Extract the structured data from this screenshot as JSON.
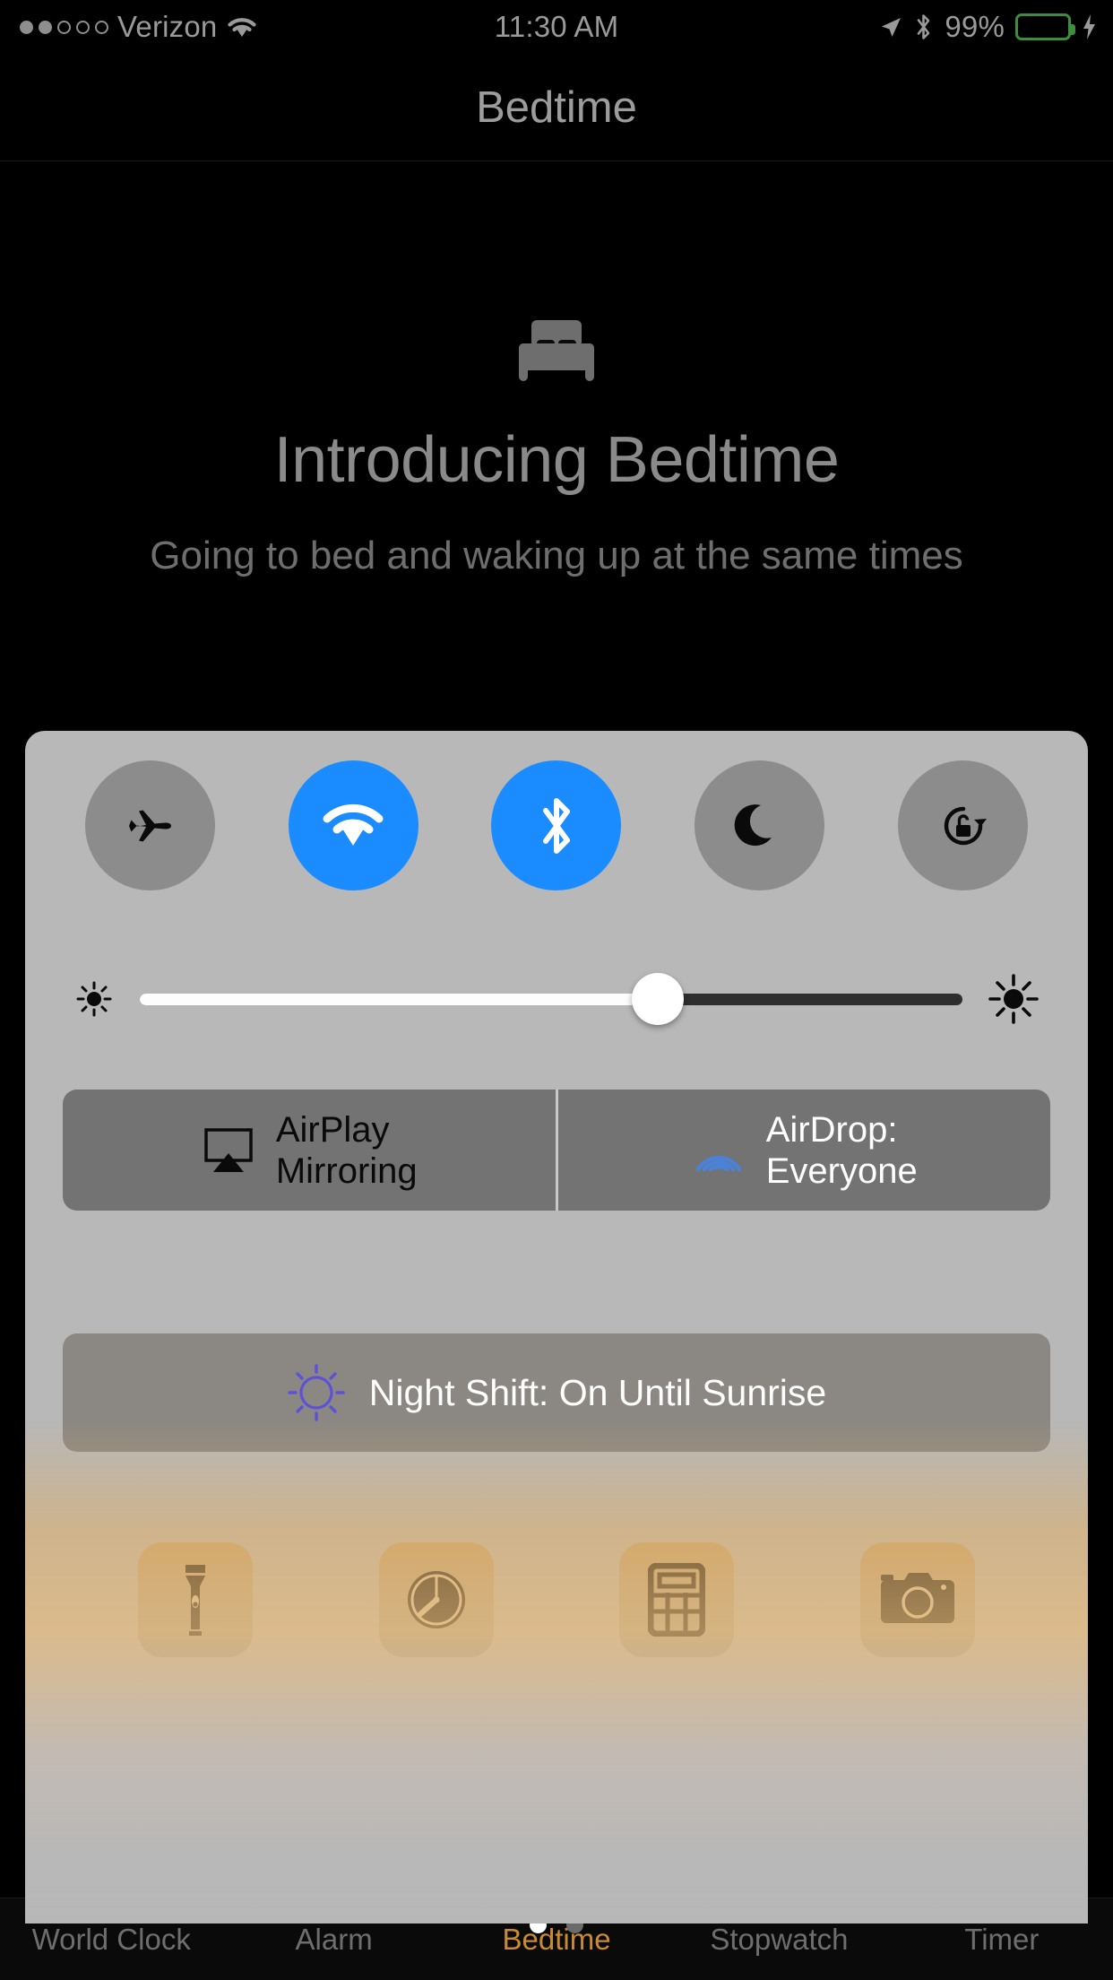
{
  "status_bar": {
    "carrier": "Verizon",
    "signal_dots_total": 5,
    "signal_dots_filled": 2,
    "wifi_icon": "wifi-icon",
    "time": "11:30 AM",
    "location_icon": "location-arrow-icon",
    "bluetooth_icon": "bluetooth-icon",
    "battery_percent": "99%",
    "battery_level": 99,
    "battery_color": "#2d7a2d",
    "charging_icon": "lightning-bolt-icon"
  },
  "nav": {
    "title": "Bedtime"
  },
  "bedtime_intro": {
    "bed_icon": "bed-icon",
    "title": "Introducing Bedtime",
    "subtitle": "Going to bed and waking up at the same times"
  },
  "control_center": {
    "accent_on_color": "#1a8cff",
    "panel_color": "#b8b8b8",
    "toggles": [
      {
        "name": "airplane-mode",
        "icon": "airplane-icon",
        "state": "off",
        "label": "Airplane Mode"
      },
      {
        "name": "wifi",
        "icon": "wifi-icon",
        "state": "on",
        "label": "Wi-Fi"
      },
      {
        "name": "bluetooth",
        "icon": "bluetooth-icon",
        "state": "on",
        "label": "Bluetooth"
      },
      {
        "name": "do-not-disturb",
        "icon": "moon-icon",
        "state": "off",
        "label": "Do Not Disturb"
      },
      {
        "name": "rotation-lock",
        "icon": "rotation-lock-icon",
        "state": "off",
        "label": "Portrait Orientation Lock"
      }
    ],
    "brightness": {
      "low_icon": "sun-small-icon",
      "high_icon": "sun-large-icon",
      "value_percent": 63
    },
    "airplay": {
      "icon": "airplay-icon",
      "label_line1": "AirPlay",
      "label_line2": "Mirroring",
      "text_color": "#0a0a0a"
    },
    "airdrop": {
      "icon": "airdrop-icon",
      "icon_color": "#4a82d8",
      "label_line1": "AirDrop:",
      "label_line2": "Everyone",
      "text_color": "#ffffff"
    },
    "night_shift": {
      "icon": "night-shift-icon",
      "icon_color": "#5d51d8",
      "label": "Night Shift: On Until Sunrise"
    },
    "shortcuts": [
      {
        "name": "flashlight",
        "icon": "flashlight-icon",
        "label": "Flashlight"
      },
      {
        "name": "timer",
        "icon": "timer-icon",
        "label": "Timer"
      },
      {
        "name": "calculator",
        "icon": "calculator-icon",
        "label": "Calculator"
      },
      {
        "name": "camera",
        "icon": "camera-icon",
        "label": "Camera"
      }
    ]
  },
  "tab_bar": {
    "active_color": "#c88a32",
    "items": [
      {
        "label": "World Clock",
        "active": false
      },
      {
        "label": "Alarm",
        "active": false
      },
      {
        "label": "Bedtime",
        "active": true
      },
      {
        "label": "Stopwatch",
        "active": false
      },
      {
        "label": "Timer",
        "active": false
      }
    ]
  },
  "page_dots": {
    "count": 2,
    "active_index": 0
  }
}
